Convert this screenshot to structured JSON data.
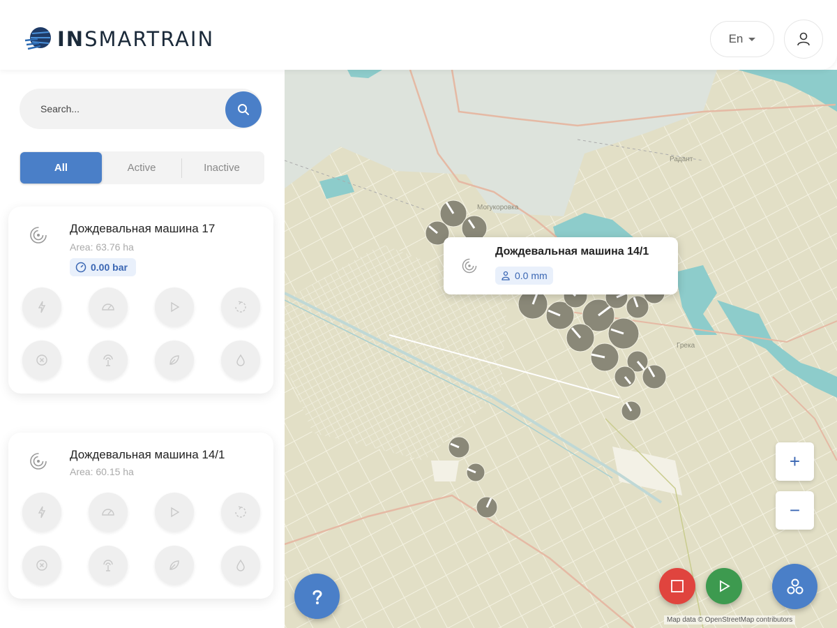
{
  "header": {
    "logo_bold": "IN",
    "logo_rest": "SMARTRAIN",
    "language": "En"
  },
  "sidebar": {
    "search_placeholder": "Search...",
    "filters": {
      "all": "All",
      "active": "Active",
      "inactive": "Inactive"
    },
    "machines": [
      {
        "name": "Дождевальная машина 17",
        "area": "Area: 63.76 ha",
        "badge": "0.00 bar"
      },
      {
        "name": "Дождевальная машина 14/1",
        "area": "Area: 60.15 ha"
      }
    ],
    "action_icons": [
      "lightning-icon",
      "speedometer-icon",
      "play-icon",
      "rotate-icon",
      "stop-circle-icon",
      "antenna-icon",
      "leaf-icon",
      "water-drop-icon"
    ]
  },
  "map": {
    "popup": {
      "title": "Дождевальная машина 14/1",
      "badge": "0.0 mm"
    },
    "place_labels": [
      "Могукоровка",
      "Радант",
      "Грека"
    ],
    "attribution": "Map data © OpenStreetMap contributors",
    "zoom_in": "+",
    "zoom_out": "−"
  },
  "colors": {
    "accent": "#4a7fc8",
    "stop": "#e0443e",
    "play": "#3d9a4f",
    "map_land": "#e2dfc6",
    "map_water": "#8dcccb",
    "pivot": "#8a8878"
  }
}
